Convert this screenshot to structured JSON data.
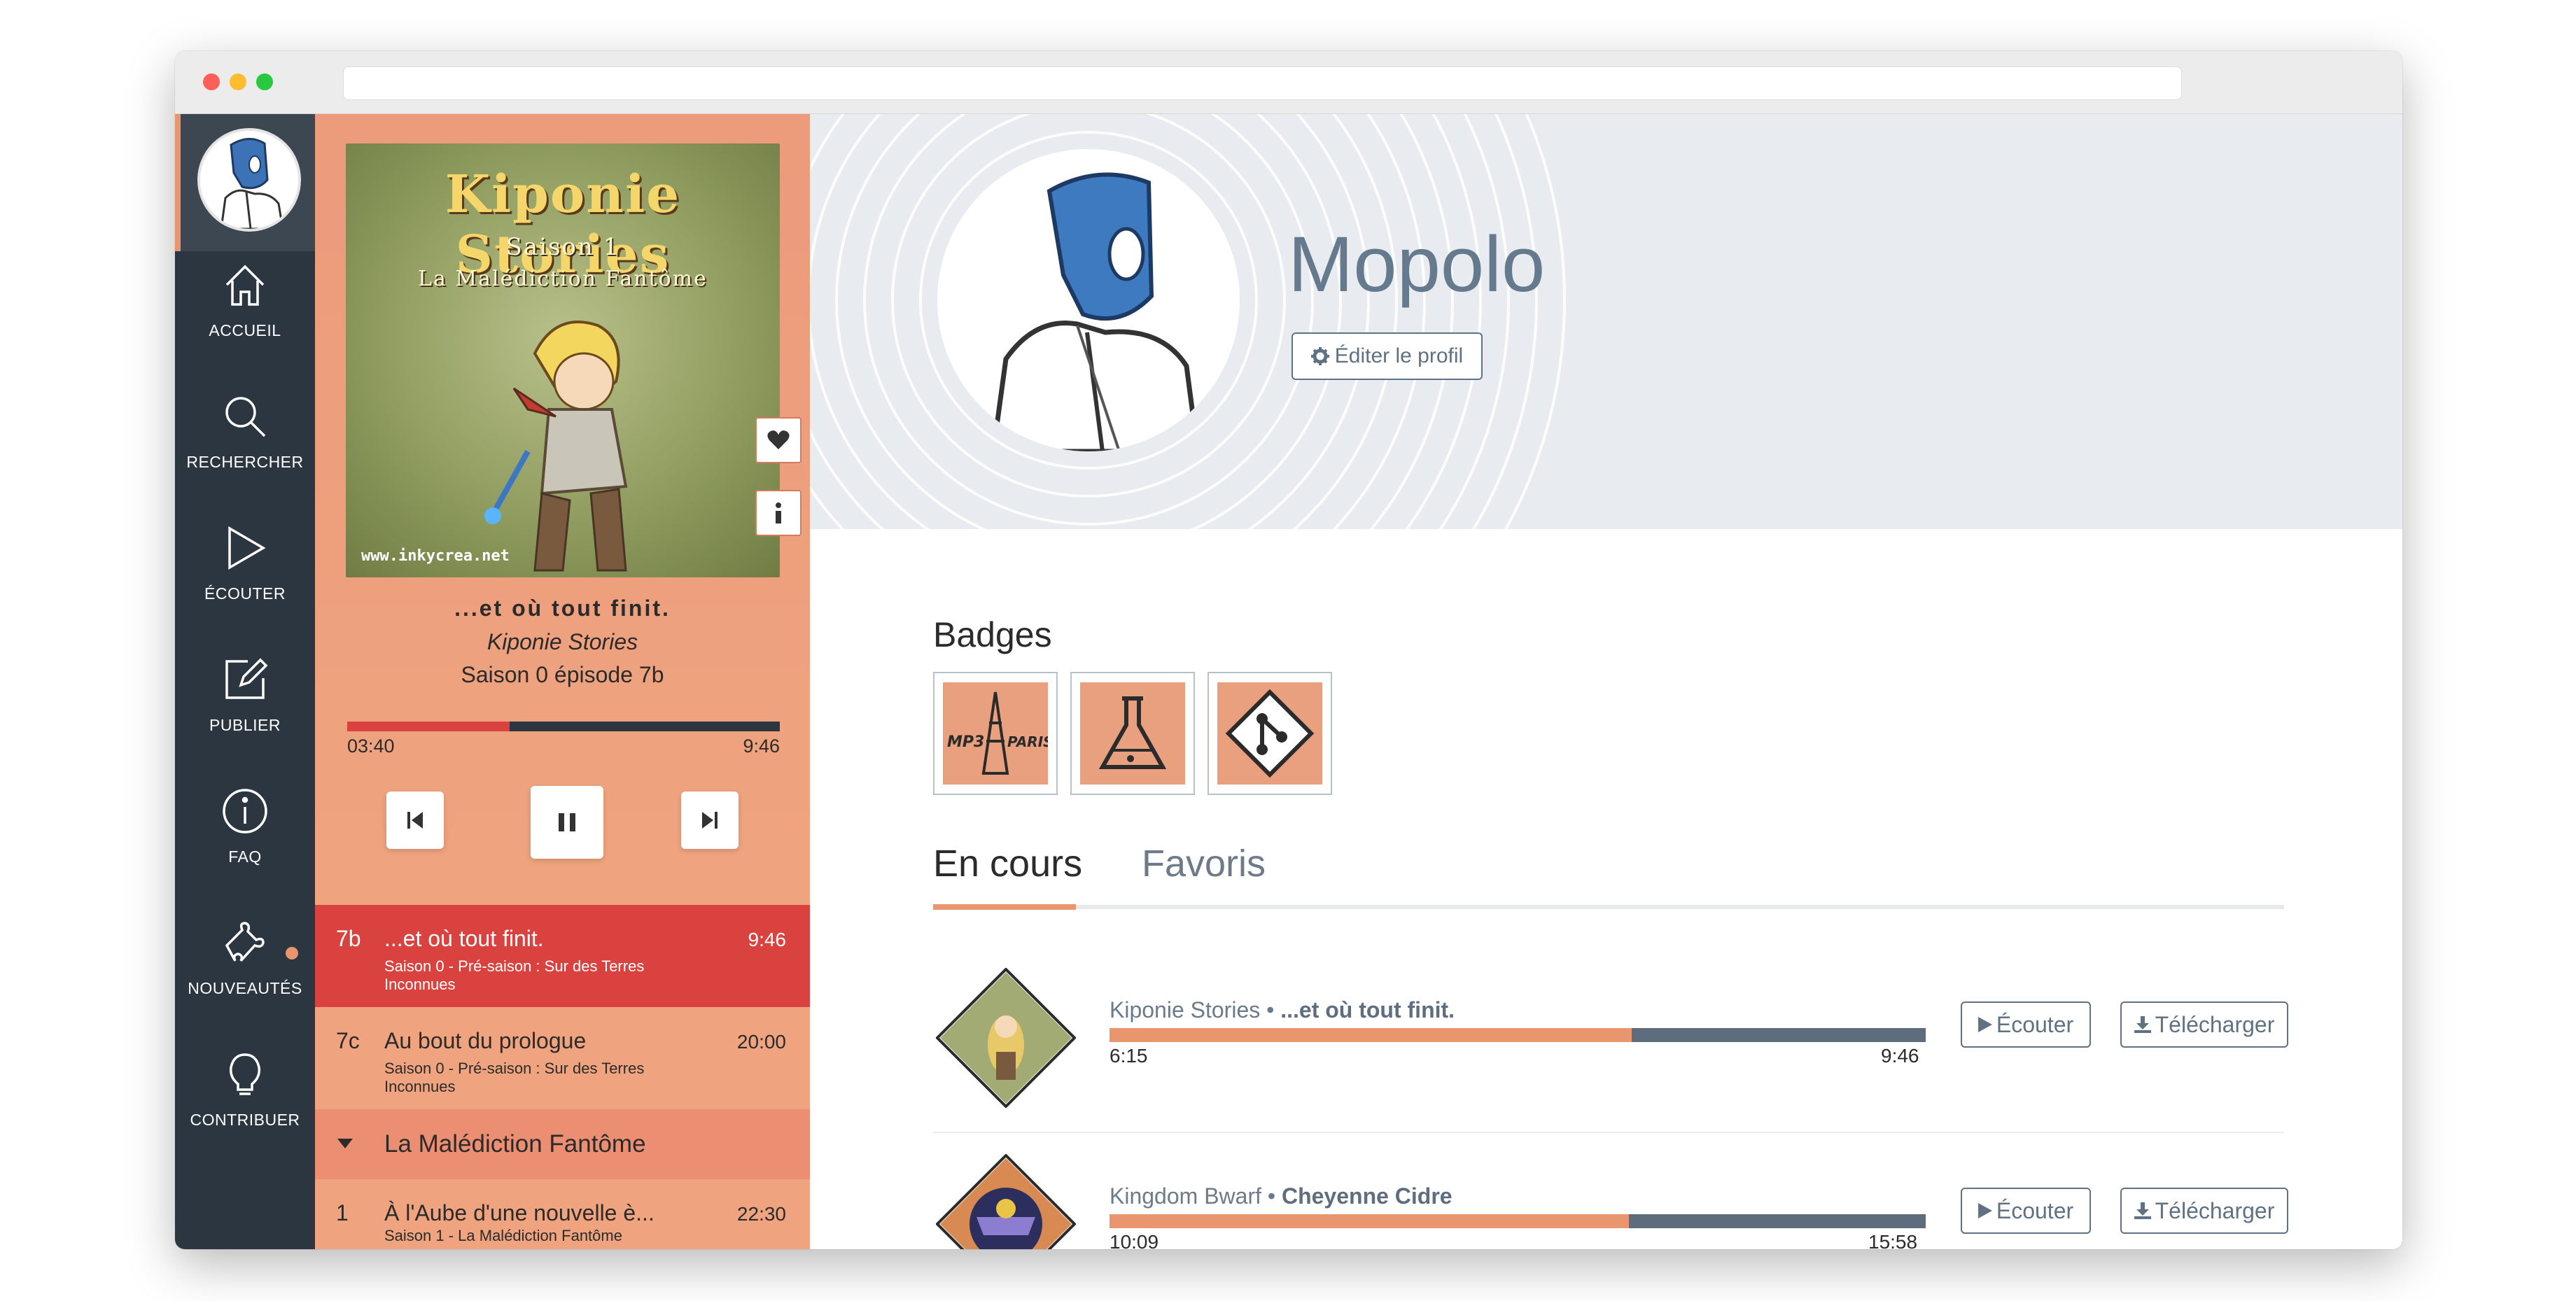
{
  "nav": {
    "items": [
      {
        "label": "ACCUEIL",
        "icon": "home-icon"
      },
      {
        "label": "RECHERCHER",
        "icon": "search-icon"
      },
      {
        "label": "ÉCOUTER",
        "icon": "play-icon"
      },
      {
        "label": "PUBLIER",
        "icon": "edit-icon"
      },
      {
        "label": "FAQ",
        "icon": "info-icon"
      },
      {
        "label": "NOUVEAUTÉS",
        "icon": "puzzle-icon"
      },
      {
        "label": "CONTRIBUER",
        "icon": "bulb-icon"
      }
    ]
  },
  "player": {
    "cover": {
      "title": "Kiponie Stories",
      "line1": "Saison 1",
      "line2": "La Malédiction Fantôme",
      "url": "www.inkycrea.net"
    },
    "track_title": "...et où tout finit.",
    "show": "Kiponie Stories",
    "episode": "Saison 0 épisode 7b",
    "elapsed": "03:40",
    "total": "9:46",
    "progress": 0.376,
    "colors": {
      "accent": "#d9423e",
      "track": "#2c3640"
    }
  },
  "playlist": {
    "episodes": [
      {
        "num": "7b",
        "title": "...et où tout finit.",
        "sub": "Saison 0 - Pré-saison : Sur des Terres Inconnues",
        "duration": "9:46"
      },
      {
        "num": "7c",
        "title": "Au bout du prologue",
        "sub": "Saison 0 - Pré-saison : Sur des Terres Inconnues",
        "duration": "20:00"
      }
    ],
    "season": "La Malédiction Fantôme",
    "next": {
      "num": "1",
      "title": "À l'Aube d'une nouvelle è...",
      "sub": "Saison 1 - La Malédiction Fantôme",
      "duration": "22:30"
    }
  },
  "profile": {
    "username": "Mopolo",
    "edit_label": "Éditer le profil"
  },
  "badges": {
    "heading": "Badges",
    "items": [
      {
        "name": "mp3-paris-badge",
        "text_left": "MP3",
        "text_right": "PARIS"
      },
      {
        "name": "flask-badge"
      },
      {
        "name": "git-badge"
      }
    ]
  },
  "tabs": {
    "active": "En cours",
    "other": "Favoris"
  },
  "in_progress": [
    {
      "show": "Kiponie Stories",
      "title": "...et où tout finit.",
      "elapsed": "6:15",
      "total": "9:46",
      "progress": 0.64,
      "listen": "Écouter",
      "download": "Télécharger"
    },
    {
      "show": "Kingdom Bwarf",
      "title": "Cheyenne Cidre",
      "elapsed": "10:09",
      "total": "15:58",
      "progress": 0.636,
      "listen": "Écouter",
      "download": "Télécharger"
    }
  ]
}
